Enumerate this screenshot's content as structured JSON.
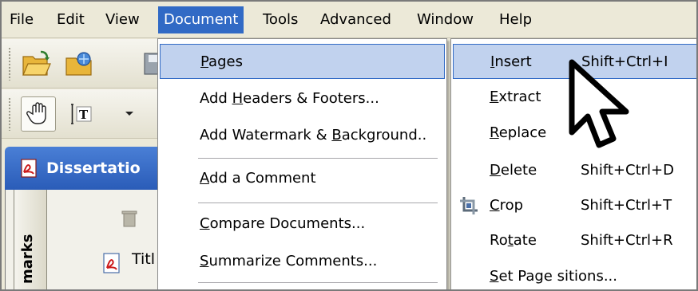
{
  "menubar": {
    "items": [
      "File",
      "Edit",
      "View",
      "Document",
      "Tools",
      "Advanced",
      "Window",
      "Help"
    ],
    "active": "Document"
  },
  "document_tab": {
    "title": "Dissertatio"
  },
  "side_panel": {
    "label": "marks",
    "row_label": "Titl"
  },
  "document_menu": {
    "items": [
      {
        "pre": "",
        "ul": "P",
        "post": "ages"
      },
      {
        "pre": "Add ",
        "ul": "H",
        "post": "eaders & Footers..."
      },
      {
        "pre": "Add Watermark & ",
        "ul": "B",
        "post": "ackground.."
      },
      {
        "pre": "",
        "ul": "A",
        "post": "dd a Comment"
      },
      {
        "pre": "",
        "ul": "C",
        "post": "ompare Documents..."
      },
      {
        "pre": "",
        "ul": "S",
        "post": "ummarize Comments..."
      }
    ]
  },
  "pages_menu": {
    "items": [
      {
        "pre": "",
        "ul": "I",
        "post": "nsert",
        "shortcut": "Shift+Ctrl+I"
      },
      {
        "pre": "",
        "ul": "E",
        "post": "xtract",
        "shortcut": ""
      },
      {
        "pre": "",
        "ul": "R",
        "post": "eplace",
        "shortcut": ""
      },
      {
        "pre": "",
        "ul": "D",
        "post": "elete",
        "shortcut": "Shift+Ctrl+D"
      },
      {
        "pre": "",
        "ul": "C",
        "post": "rop",
        "shortcut": "Shift+Ctrl+T"
      },
      {
        "pre": "Ro",
        "ul": "t",
        "post": "ate",
        "shortcut": "Shift+Ctrl+R"
      },
      {
        "pre": "",
        "ul": "S",
        "post": "et Page sitions...",
        "shortcut": ""
      }
    ]
  },
  "colors": {
    "menu_active": "#316ac5",
    "menu_highlight": "#c1d2ee",
    "title_bar": "#2a5cb8"
  }
}
